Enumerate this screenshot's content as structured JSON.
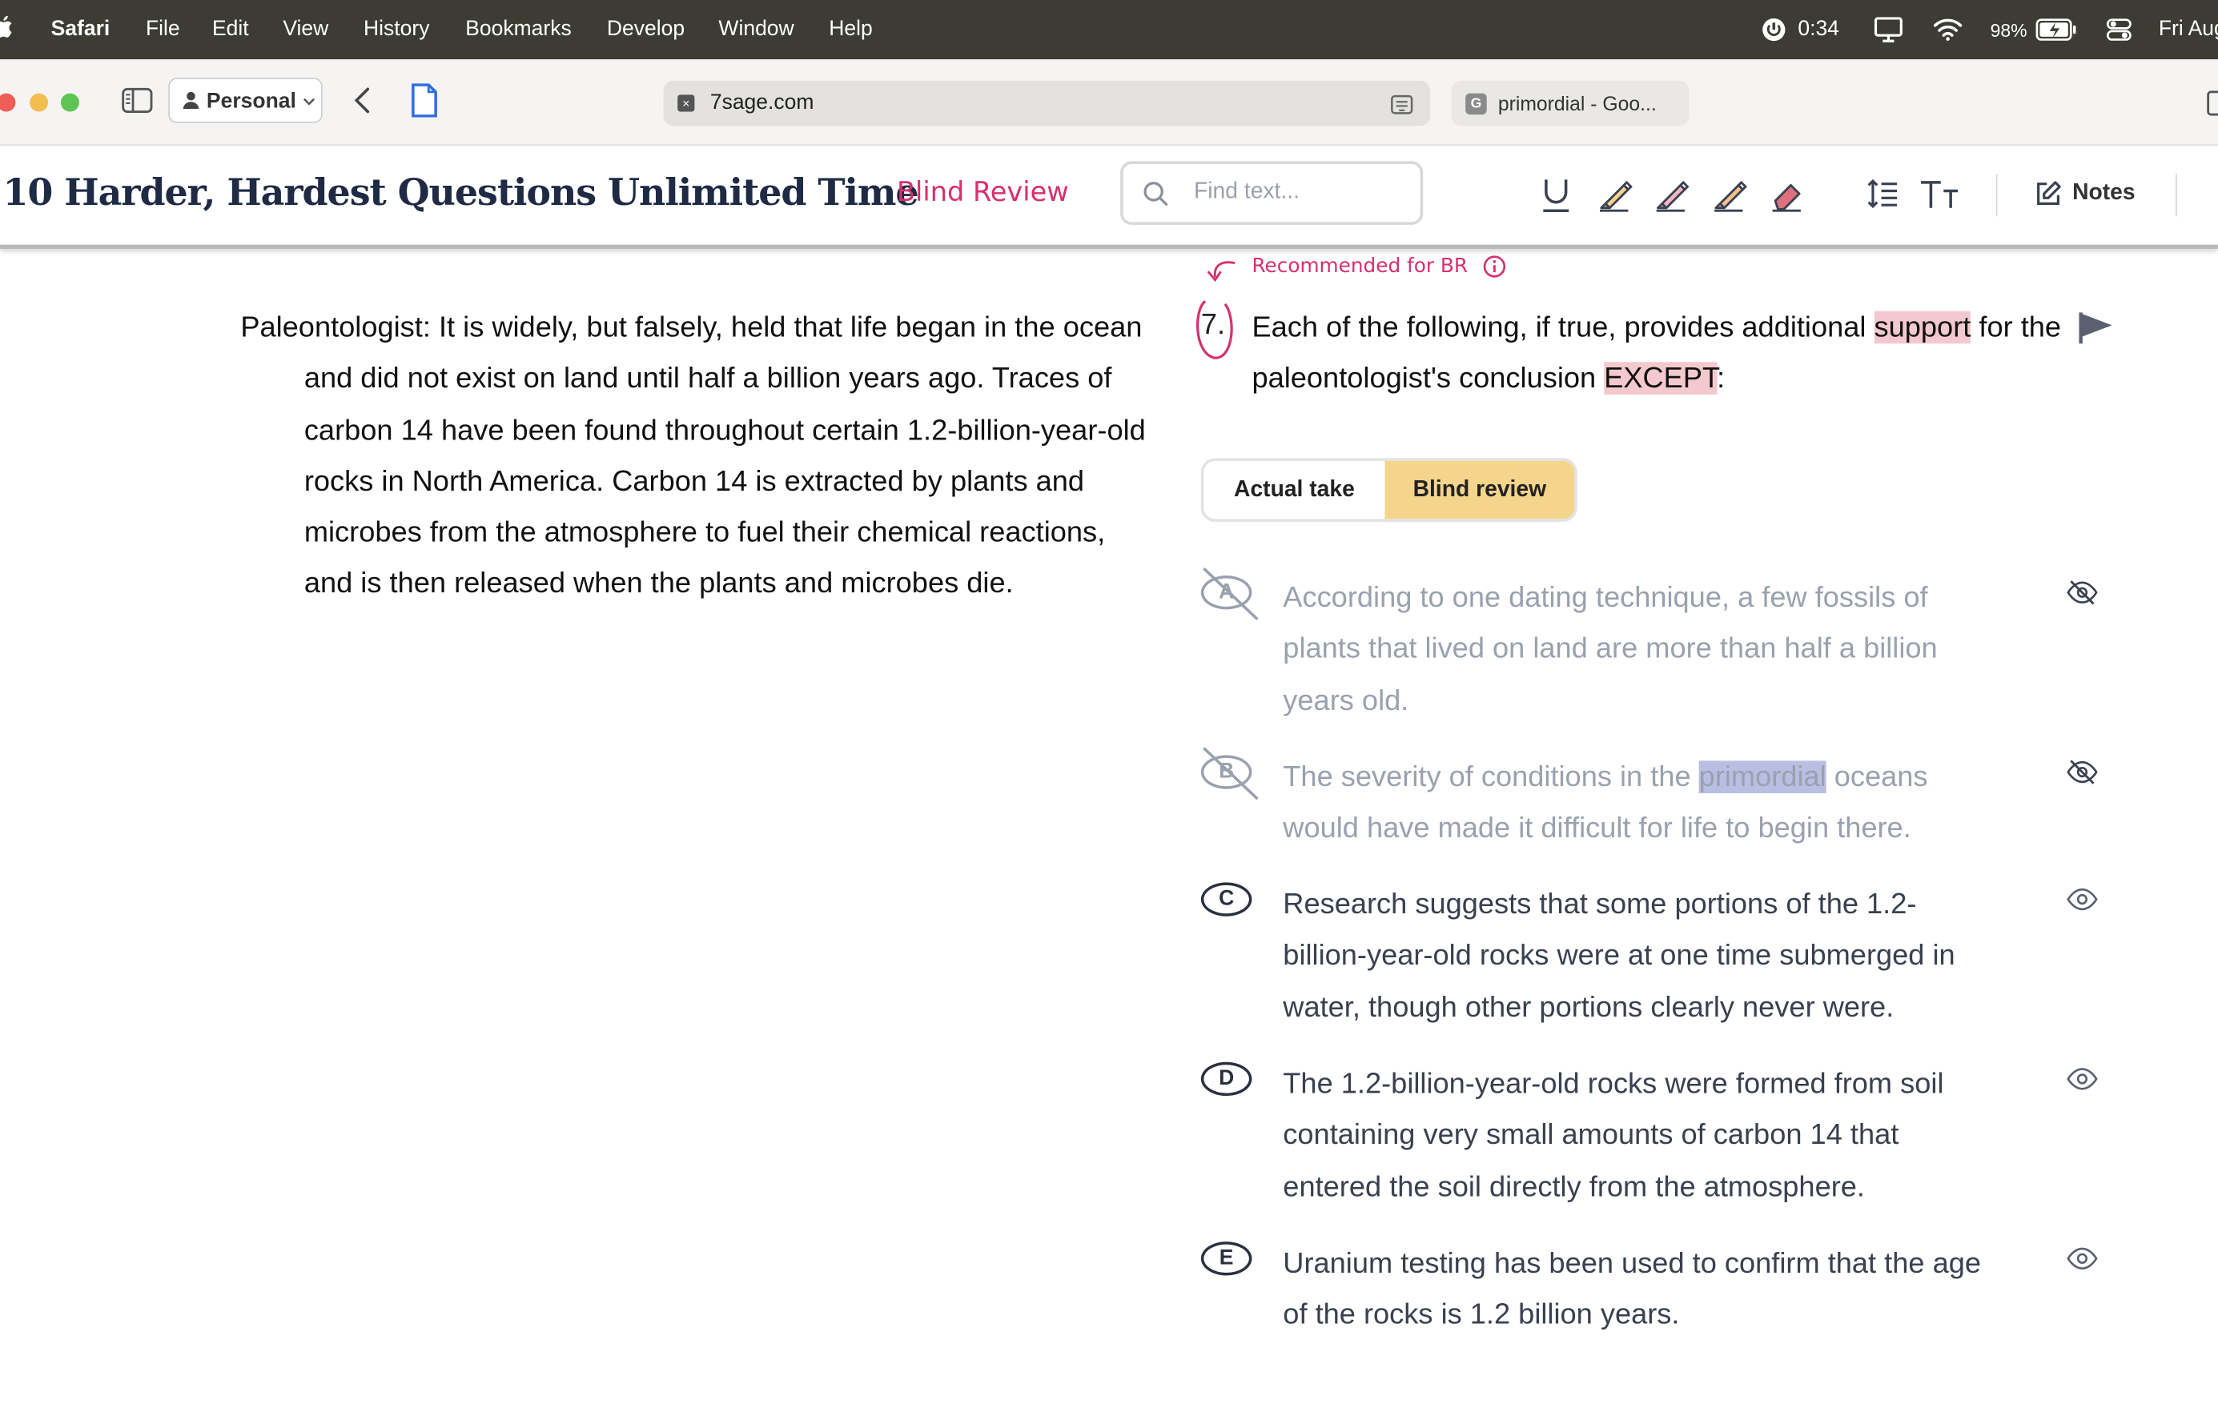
{
  "menubar": {
    "app": "Safari",
    "items": [
      "File",
      "Edit",
      "View",
      "History",
      "Bookmarks",
      "Develop",
      "Window",
      "Help"
    ],
    "timer": "0:34",
    "battery": "98%",
    "date": "Fri Aug"
  },
  "browser": {
    "profile": "Personal",
    "url": "7sage.com",
    "other_tab": "primordial - Goo..."
  },
  "header": {
    "title": "10 Harder, Hardest Questions Unlimited Time",
    "mode_tag": "Blind Review",
    "find_placeholder": "Find text...",
    "notes_label": "Notes"
  },
  "stimulus": {
    "text": "Paleontologist: It is widely, but falsely, held that life began in the ocean and did not exist on land until half a billion years ago. Traces of carbon 14 have been found throughout certain 1.2-billion-year-old rocks in North America. Carbon 14 is extracted by plants and microbes from the atmosphere to fuel their chemical reactions, and is then released when the plants and microbes die."
  },
  "question": {
    "recommended_note": "Recommended for BR",
    "number": "7.",
    "stem_part1": "Each of the following, if true, provides additional ",
    "stem_hl1": "support",
    "stem_part2": " for the paleontologist's conclusion ",
    "stem_hl2": "EXCEPT",
    "stem_part3": ":"
  },
  "toggle": {
    "actual": "Actual take",
    "blind": "Blind review",
    "active": "blind"
  },
  "choices": [
    {
      "letter": "A",
      "text": "According to one dating technique, a few fossils of plants that lived on land are more than half a billion years old.",
      "eliminated": true
    },
    {
      "letter": "B",
      "text_pre": "The severity of conditions in the ",
      "text_sel": "primordial",
      "text_post": " oceans would have made it difficult for life to begin there.",
      "eliminated": true
    },
    {
      "letter": "C",
      "text": "Research suggests that some portions of the 1.2-billion-year-old rocks were at one time submerged in water, though other portions clearly never were.",
      "eliminated": false
    },
    {
      "letter": "D",
      "text": "The 1.2-billion-year-old rocks were formed from soil containing very small amounts of carbon 14 that entered the soil directly from the atmosphere.",
      "eliminated": false
    },
    {
      "letter": "E",
      "text": "Uranium testing has been used to confirm that the age of the rocks is 1.2 billion years.",
      "eliminated": false
    }
  ],
  "colors": {
    "accent_pink": "#d6306e",
    "highlight": "#f3c9cf",
    "toggle_active": "#f5d48c",
    "title_navy": "#1f2a44"
  }
}
